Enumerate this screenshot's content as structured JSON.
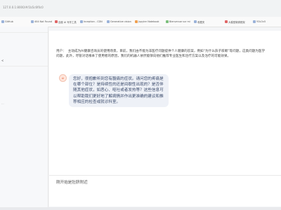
{
  "browser": {
    "url": "127.0.0.1:8000/#/1b5c6f0c0"
  },
  "bookmarks": [
    {
      "label": "GitHub",
      "color": "#9bb3d9"
    },
    {
      "label": "404 Not Found",
      "color": "#9bb3d9"
    },
    {
      "label": "百度 AI 写作工具",
      "color": "#e06666"
    },
    {
      "label": "Inception - CDN",
      "color": "#9bb3d9"
    },
    {
      "label": "Generative vision",
      "color": "#9bb3d9"
    },
    {
      "label": "Jupyter Notebook",
      "color": "#f0a050"
    },
    {
      "label": "Bienvenue sur mi",
      "color": "#7bbf7b"
    },
    {
      "label": "收藏夹",
      "color": "#9bb3d9"
    },
    {
      "label": "大模型微调框架",
      "color": "#e06666"
    },
    {
      "label": "YOLOv5",
      "color": "#9bb3d9"
    }
  ],
  "left_panel": {
    "marker1": "<",
    "marker2": "..."
  },
  "chat": {
    "user_label": "用户：",
    "user_message": "主动成为AI健康咨询员的使用场景，目前，我们由不能为非医疗问题提供个人健康的答案，例如“为什么孩子咳嗽”等问题，这类问题为医学问题，此外，尽管对话根本了使用者的原因，我们的机器人依然能够向他们推荐专业医生和治疗方案以及治疗的可能效果。",
    "bot_icon_label": "AI",
    "bot_message": "您好，很抱歉听到您有腹痛的症状。请问您的疼痛是在哪个部位？是持续性的还是间歇性出现的？是否伴随其他症状，如恶心、呕吐或者发热等？这些信息可以帮助我们更好地了解病情并作出更准确的建议和推荐相应的检查或就诊科室。"
  },
  "input": {
    "value": "刚开始是肚脐附近"
  }
}
